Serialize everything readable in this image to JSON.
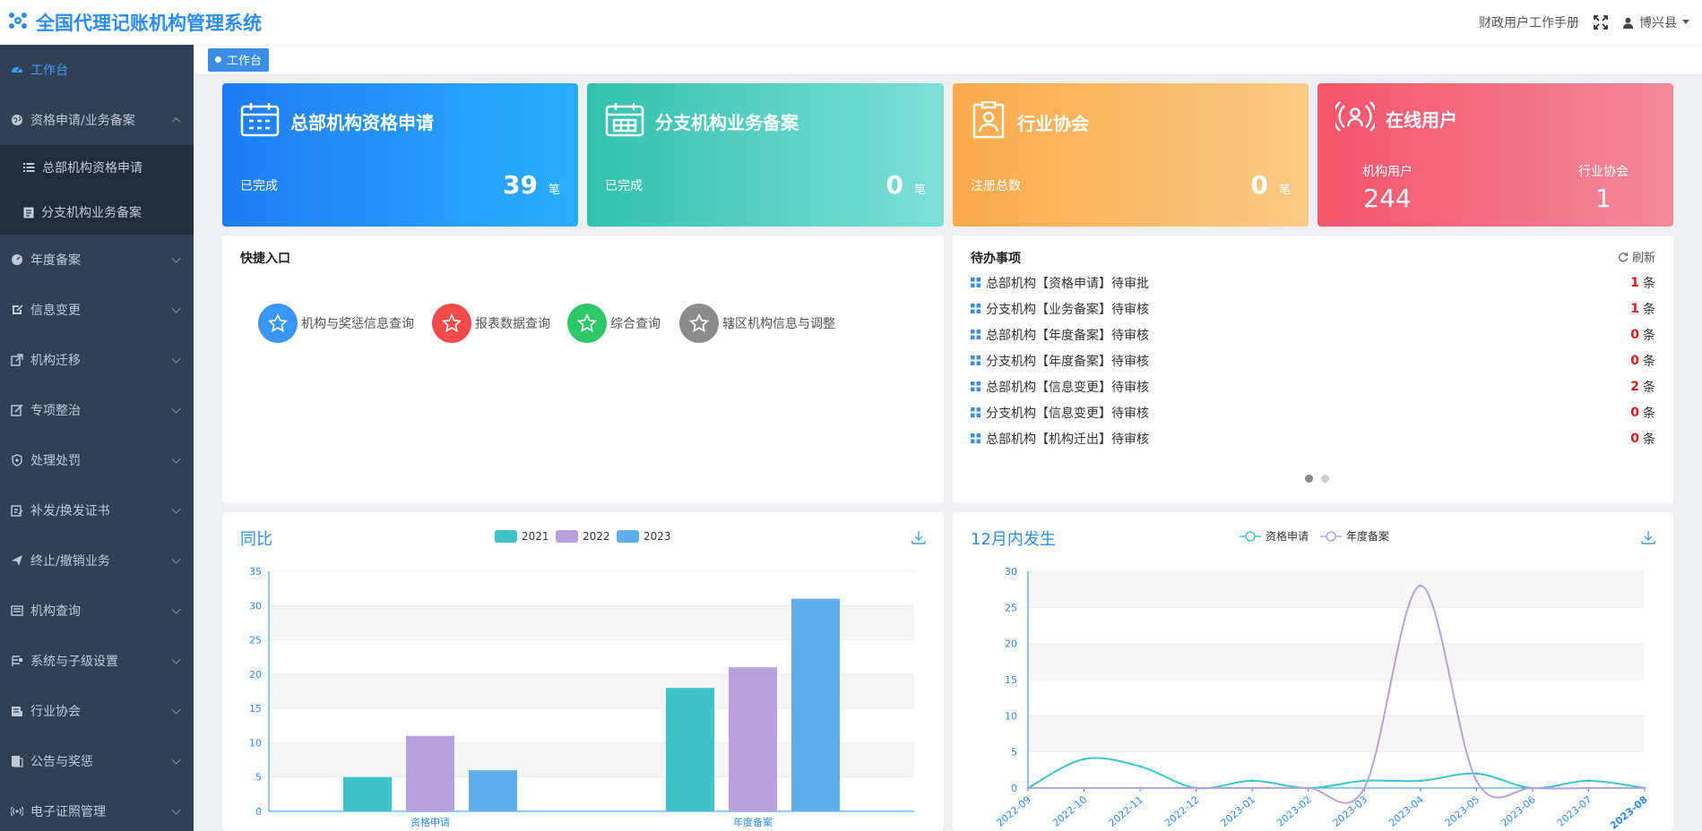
{
  "header": {
    "title": "全国代理记账机构管理系统",
    "manual_label": "财政用户工作手册",
    "user_label": "博兴县"
  },
  "sidebar": {
    "workbench": "工作台",
    "qualification": "资格申请/业务备案",
    "sub_hq": "总部机构资格申请",
    "sub_branch": "分支机构业务备案",
    "items": [
      "年度备案",
      "信息变更",
      "机构迁移",
      "专项整治",
      "处理处罚",
      "补发/换发证书",
      "终止/撤销业务",
      "机构查询",
      "系统与子级设置",
      "行业协会",
      "公告与奖惩",
      "电子证照管理"
    ]
  },
  "tags": {
    "workbench": "工作台"
  },
  "cards": [
    {
      "title": "总部机构资格申请",
      "label": "已完成",
      "value": "39",
      "unit": "笔",
      "color_from": "#1f7cf5",
      "color_to": "#2aaefc"
    },
    {
      "title": "分支机构业务备案",
      "label": "已完成",
      "value": "0",
      "unit": "笔",
      "color_from": "#33c1ad",
      "color_to": "#7ddfd7"
    },
    {
      "title": "行业协会",
      "label": "注册总数",
      "value": "0",
      "unit": "笔",
      "color_from": "#fba94b",
      "color_to": "#f8cb86"
    },
    {
      "title": "在线用户",
      "col1_label": "机构用户",
      "col1_value": "244",
      "col2_label": "行业协会",
      "col2_value": "1",
      "color_from": "#f4536b",
      "color_to": "#f38b9b"
    }
  ],
  "quick": {
    "title": "快捷入口",
    "items": [
      {
        "label": "机构与奖惩信息查询",
        "color": "#3b95f4"
      },
      {
        "label": "报表数据查询",
        "color": "#f34b4b"
      },
      {
        "label": "综合查询",
        "color": "#2fc868"
      },
      {
        "label": "辖区机构信息与调整",
        "color": "#8c8c8c"
      }
    ]
  },
  "todo": {
    "title": "待办事项",
    "refresh": "刷新",
    "unit": "条",
    "items": [
      {
        "label": "总部机构【资格申请】待审批",
        "count": "1"
      },
      {
        "label": "分支机构【业务备案】待审核",
        "count": "1"
      },
      {
        "label": "总部机构【年度备案】待审核",
        "count": "0"
      },
      {
        "label": "分支机构【年度备案】待审核",
        "count": "0"
      },
      {
        "label": "总部机构【信息变更】待审核",
        "count": "2"
      },
      {
        "label": "分支机构【信息变更】待审核",
        "count": "0"
      },
      {
        "label": "总部机构【机构迁出】待审核",
        "count": "0"
      }
    ]
  },
  "chart_data": [
    {
      "type": "bar",
      "title": "同比",
      "categories": [
        "资格申请",
        "年度备案"
      ],
      "series": [
        {
          "name": "2021",
          "values": [
            5,
            18
          ],
          "color": "#3fc3c9"
        },
        {
          "name": "2022",
          "values": [
            11,
            21
          ],
          "color": "#b5a2dd"
        },
        {
          "name": "2023",
          "values": [
            6,
            31
          ],
          "color": "#62aeea"
        }
      ],
      "ylim": [
        0,
        35
      ],
      "yticks": [
        0,
        5,
        10,
        15,
        20,
        25,
        30,
        35
      ],
      "legend": "top-center"
    },
    {
      "type": "line",
      "title": "12月内发生",
      "x": [
        "2022-09",
        "2022-10",
        "2022-11",
        "2022-12",
        "2023-01",
        "2023-02",
        "2023-03",
        "2023-04",
        "2023-05",
        "2023-06",
        "2023-07",
        "2023-08"
      ],
      "series": [
        {
          "name": "资格申请",
          "values": [
            0,
            4,
            3,
            0,
            1,
            0,
            1,
            1,
            2,
            0,
            1,
            0
          ],
          "color": "#3fc3c9"
        },
        {
          "name": "年度备案",
          "values": [
            0,
            0,
            0,
            0,
            0,
            0,
            0,
            28,
            1,
            0,
            0,
            0
          ],
          "color": "#b5a2dd"
        }
      ],
      "ylim": [
        0,
        30
      ],
      "yticks": [
        0,
        5,
        10,
        15,
        20,
        25,
        30
      ],
      "legend": "top-center"
    }
  ]
}
